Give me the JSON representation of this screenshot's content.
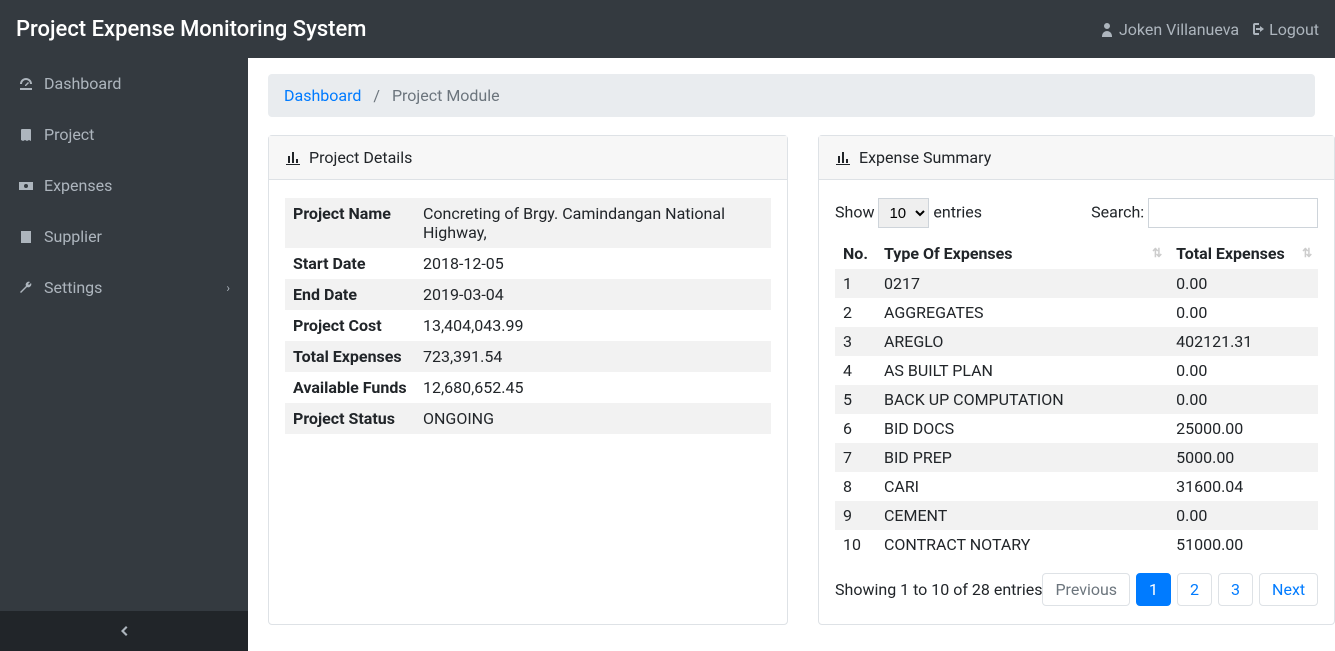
{
  "header": {
    "brand": "Project Expense Monitoring System",
    "user": "Joken Villanueva",
    "logout": "Logout"
  },
  "sidebar": {
    "items": [
      {
        "label": "Dashboard",
        "icon": "dashboard-icon",
        "has_sub": false
      },
      {
        "label": "Project",
        "icon": "book-icon",
        "has_sub": false
      },
      {
        "label": "Expenses",
        "icon": "money-icon",
        "has_sub": false
      },
      {
        "label": "Supplier",
        "icon": "address-icon",
        "has_sub": false
      },
      {
        "label": "Settings",
        "icon": "wrench-icon",
        "has_sub": true
      }
    ]
  },
  "breadcrumb": {
    "home": "Dashboard",
    "current": "Project Module"
  },
  "project_details": {
    "card_title": "Project Details",
    "rows": [
      {
        "label": "Project Name",
        "value": "Concreting of Brgy. Camindangan National Highway,"
      },
      {
        "label": "Start Date",
        "value": "2018-12-05"
      },
      {
        "label": "End Date",
        "value": "2019-03-04"
      },
      {
        "label": "Project Cost",
        "value": "13,404,043.99"
      },
      {
        "label": "Total Expenses",
        "value": "723,391.54"
      },
      {
        "label": "Available Funds",
        "value": "12,680,652.45"
      },
      {
        "label": "Project Status",
        "value": "ONGOING"
      }
    ]
  },
  "expense_summary": {
    "card_title": "Expense Summary",
    "show_label": "Show",
    "entries_label": "entries",
    "length_value": "10",
    "search_label": "Search:",
    "columns": {
      "no": "No.",
      "type": "Type Of Expenses",
      "total": "Total Expenses"
    },
    "rows": [
      {
        "no": "1",
        "type": "0217",
        "total": "0.00"
      },
      {
        "no": "2",
        "type": "AGGREGATES",
        "total": "0.00"
      },
      {
        "no": "3",
        "type": "AREGLO",
        "total": "402121.31"
      },
      {
        "no": "4",
        "type": "AS BUILT PLAN",
        "total": "0.00"
      },
      {
        "no": "5",
        "type": "BACK UP COMPUTATION",
        "total": "0.00"
      },
      {
        "no": "6",
        "type": "BID DOCS",
        "total": "25000.00"
      },
      {
        "no": "7",
        "type": "BID PREP",
        "total": "5000.00"
      },
      {
        "no": "8",
        "type": "CARI",
        "total": "31600.04"
      },
      {
        "no": "9",
        "type": "CEMENT",
        "total": "0.00"
      },
      {
        "no": "10",
        "type": "CONTRACT NOTARY",
        "total": "51000.00"
      }
    ],
    "info": "Showing 1 to 10 of 28 entries",
    "pagination": {
      "prev": "Previous",
      "pages": [
        "1",
        "2",
        "3"
      ],
      "next": "Next",
      "active": "1"
    }
  }
}
